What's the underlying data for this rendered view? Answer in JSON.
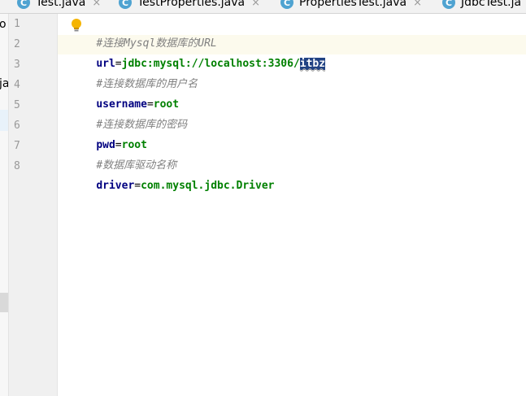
{
  "tabs": [
    {
      "label": "Test.java",
      "icon": "class-icon"
    },
    {
      "label": "TestProperties.java",
      "icon": "class-icon"
    },
    {
      "label": "PropertiesTest.java",
      "icon": "class-icon"
    },
    {
      "label": "JdbcTest.ja",
      "icon": "class-icon"
    }
  ],
  "tab_icon_letter": "C",
  "tab_close_glyph": "×",
  "left_strip": {
    "top_text": "o",
    "side_text": "ja"
  },
  "line_numbers": [
    "1",
    "2",
    "3",
    "4",
    "5",
    "6",
    "7",
    "8"
  ],
  "code": {
    "line1": {
      "hash": "#",
      "comment": "连接Mysql数据库的URL"
    },
    "line2": {
      "key": "url",
      "eq": "=",
      "value": "jdbc:mysql://localhost:3306/",
      "selected": "itbz"
    },
    "line3": {
      "comment": "#连接数据库的用户名"
    },
    "line4": {
      "key": "username",
      "eq": "=",
      "value": "root"
    },
    "line5": {
      "comment": "#连接数据库的密码"
    },
    "line6": {
      "key": "pwd",
      "eq": "=",
      "value": "root"
    },
    "line7": {
      "comment": "#数据库驱动名称"
    },
    "line8": {
      "key": "driver",
      "eq": "=",
      "value": "com.mysql.jdbc.Driver"
    }
  },
  "colors": {
    "comment": "#808080",
    "key": "#000080",
    "value": "#008000",
    "current_line": "#fcfaed",
    "selection": "#214283",
    "tab_icon": "#4fa3d1",
    "bulb": "#f5b400"
  }
}
